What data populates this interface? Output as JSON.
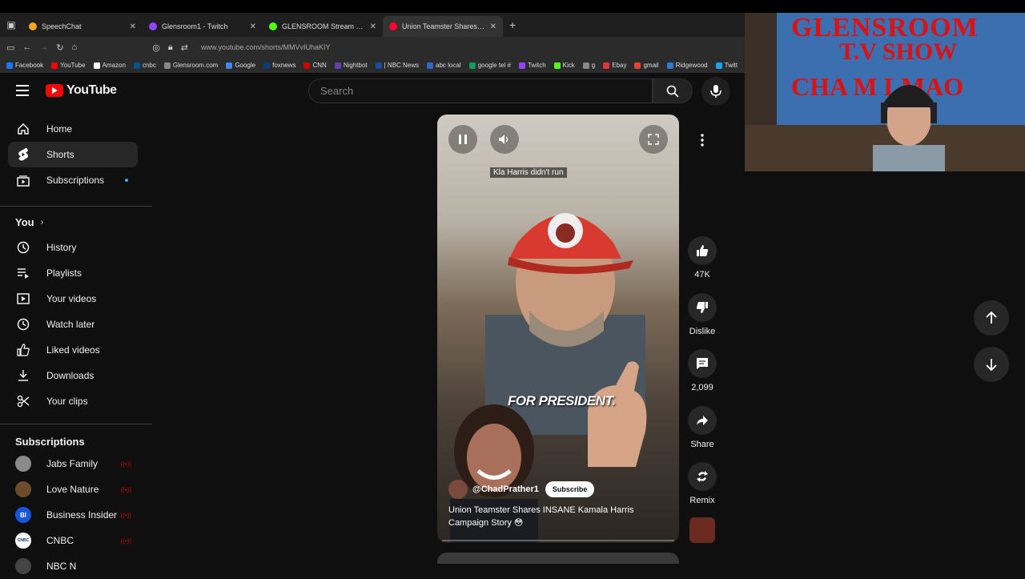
{
  "browser": {
    "tabs": [
      {
        "title": "SpeechChat",
        "color": "#f4a21f"
      },
      {
        "title": "Glensroom1 - Twitch",
        "color": "#9146ff"
      },
      {
        "title": "GLENSROOM Stream - Watch Li",
        "color": "#53fc18"
      },
      {
        "title": "Union Teamster Shares INSA",
        "color": "#ff0033"
      }
    ],
    "url": "www.youtube.com/shorts/MMVvIUhaKIY",
    "bookmarks": [
      "Facebook",
      "YouTube",
      "Amazon",
      "cnbc",
      "Glensroom.com",
      "Google",
      "foxnews",
      "CNN",
      "Nightbot",
      "| NBC News",
      "abc local",
      "google tel #",
      "Twitch",
      "Kick",
      "g",
      "Ebay",
      "gmail",
      "Ridgewood",
      "Twitt"
    ]
  },
  "header": {
    "logo_text": "YouTube",
    "search_placeholder": "Search"
  },
  "sidebar": {
    "main": [
      {
        "label": "Home",
        "icon": "home-icon"
      },
      {
        "label": "Shorts",
        "icon": "shorts-icon"
      },
      {
        "label": "Subscriptions",
        "icon": "subscriptions-icon"
      }
    ],
    "you_title": "You",
    "you": [
      {
        "label": "History",
        "icon": "history-icon"
      },
      {
        "label": "Playlists",
        "icon": "playlists-icon"
      },
      {
        "label": "Your videos",
        "icon": "your-videos-icon"
      },
      {
        "label": "Watch later",
        "icon": "watch-later-icon"
      },
      {
        "label": "Liked videos",
        "icon": "liked-icon"
      },
      {
        "label": "Downloads",
        "icon": "download-icon"
      },
      {
        "label": "Your clips",
        "icon": "clips-icon"
      }
    ],
    "subs_title": "Subscriptions",
    "subs": [
      {
        "label": "Jabs Family",
        "color": "#8a8a8a",
        "initials": ""
      },
      {
        "label": "Love Nature",
        "color": "#6b4b2a",
        "initials": ""
      },
      {
        "label": "Business Insider",
        "color": "#1a56db",
        "initials": "BI"
      },
      {
        "label": "CNBC",
        "color": "#ffffff",
        "initials": "CNBC"
      },
      {
        "label": "NBC N",
        "color": "#444444",
        "initials": ""
      }
    ]
  },
  "short": {
    "overlay_caption": "Kla Harris didn't run",
    "on_screen_text": "FOR PRESIDENT.",
    "channel": "@ChadPrather1",
    "subscribe_label": "Subscribe",
    "title": "Union Teamster Shares INSANE Kamala Harris Campaign Story 😳"
  },
  "actions": {
    "likes": "47K",
    "dislike_label": "Dislike",
    "comments": "2,099",
    "share_label": "Share",
    "remix_label": "Remix"
  },
  "webcam": {
    "line1": "GLENSROOM",
    "line2": "T.V SHOW",
    "line3": "CHA    M LMAO"
  }
}
